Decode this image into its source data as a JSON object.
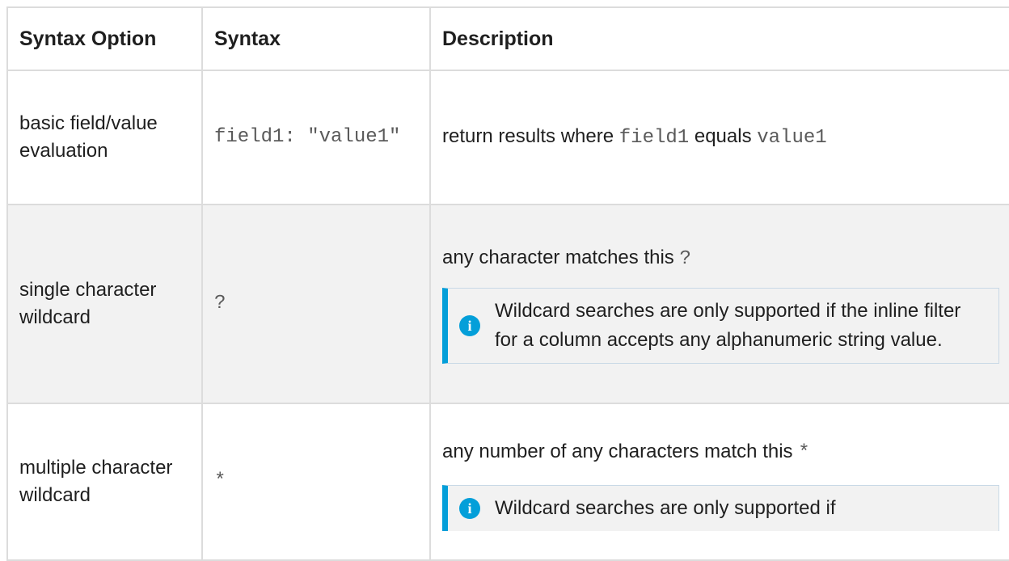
{
  "table": {
    "headers": [
      "Syntax Option",
      "Syntax",
      "Description"
    ],
    "rows": [
      {
        "option": "basic field/value evaluation",
        "syntax": "field1: \"value1\"",
        "description": {
          "pre": "return results where ",
          "code1": "field1",
          "mid": " equals ",
          "code2": "value1"
        }
      },
      {
        "option": "single character wildcard",
        "syntax": "?",
        "description": {
          "text": "any character matches this ",
          "code": "?"
        },
        "note": {
          "icon": "info-icon",
          "text": "Wildcard searches are only supported if the inline filter for a column accepts any alphanumeric string value."
        }
      },
      {
        "option": "multiple character wildcard",
        "syntax": "*",
        "description": {
          "text": "any number of any characters match this ",
          "code": "*"
        },
        "note": {
          "icon": "info-icon",
          "text": "Wildcard searches are only supported if"
        }
      }
    ]
  },
  "colors": {
    "accent": "#049fd9",
    "border": "#dcdcdc",
    "shaded_row": "#f2f2f2"
  }
}
